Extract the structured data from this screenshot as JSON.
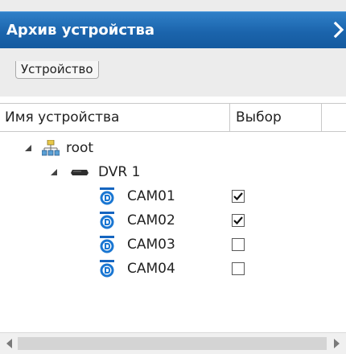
{
  "panel": {
    "title": "Архив устройства",
    "collapse_icon": "chevron-right-icon"
  },
  "tabs": [
    {
      "label": "Устройство",
      "selected": true
    }
  ],
  "table": {
    "columns": {
      "name": "Имя устройства",
      "select": "Выбор"
    },
    "tree": {
      "root": {
        "label": "root",
        "icon": "network-icon",
        "expanded": true
      },
      "dvr": {
        "label": "DVR 1",
        "icon": "dvr-icon",
        "expanded": true
      },
      "cameras": [
        {
          "label": "CAM01",
          "checked": true,
          "icon": "camera-icon"
        },
        {
          "label": "CAM02",
          "checked": true,
          "icon": "camera-icon"
        },
        {
          "label": "CAM03",
          "checked": false,
          "icon": "camera-icon"
        },
        {
          "label": "CAM04",
          "checked": false,
          "icon": "camera-icon"
        }
      ]
    }
  },
  "colors": {
    "title_bar": "#1b64ac",
    "camera_icon": "#1565c0"
  }
}
